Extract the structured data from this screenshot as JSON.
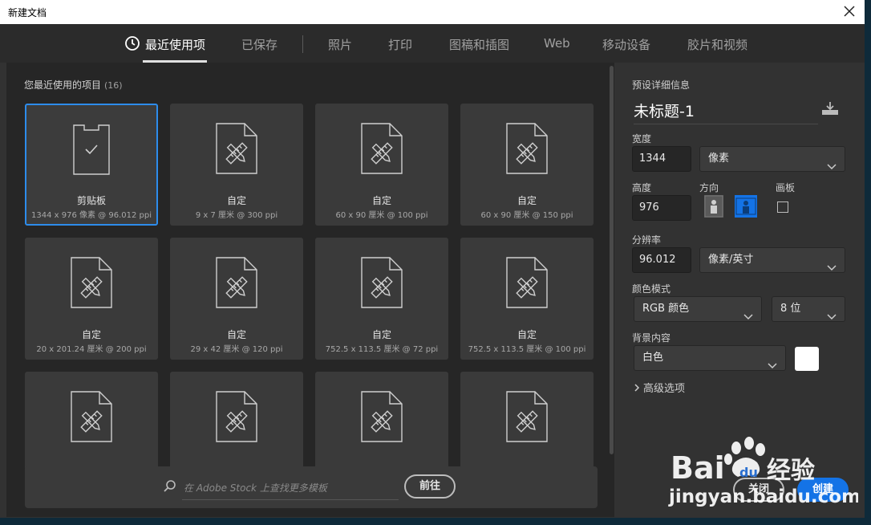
{
  "window": {
    "title": "新建文档"
  },
  "tabs": [
    {
      "label": "最近使用项",
      "active": true
    },
    {
      "label": "已保存"
    },
    {
      "label": "照片"
    },
    {
      "label": "打印"
    },
    {
      "label": "图稿和插图"
    },
    {
      "label": "Web"
    },
    {
      "label": "移动设备"
    },
    {
      "label": "胶片和视频"
    }
  ],
  "recent": {
    "title": "您最近使用的项目",
    "count": "(16)",
    "items": [
      {
        "name": "剪贴板",
        "desc": "1344 x 976 像素 @ 96.012 ppi",
        "icon": "clipboard-check-icon",
        "selected": true
      },
      {
        "name": "自定",
        "desc": "9 x 7 厘米 @ 300 ppi",
        "icon": "custom-document-icon"
      },
      {
        "name": "自定",
        "desc": "60 x 90 厘米 @ 100 ppi",
        "icon": "custom-document-icon"
      },
      {
        "name": "自定",
        "desc": "60 x 90 厘米 @ 150 ppi",
        "icon": "custom-document-icon"
      },
      {
        "name": "自定",
        "desc": "20 x 201.24 厘米 @ 200 ppi",
        "icon": "custom-document-icon"
      },
      {
        "name": "自定",
        "desc": "29 x 42 厘米 @ 120 ppi",
        "icon": "custom-document-icon"
      },
      {
        "name": "自定",
        "desc": "752.5 x 113.5 厘米 @ 72 ppi",
        "icon": "custom-document-icon"
      },
      {
        "name": "自定",
        "desc": "752.5 x 113.5 厘米 @ 100 ppi",
        "icon": "custom-document-icon"
      },
      {
        "name": "",
        "desc": "",
        "icon": "custom-document-icon"
      },
      {
        "name": "",
        "desc": "",
        "icon": "custom-document-icon"
      },
      {
        "name": "",
        "desc": "",
        "icon": "custom-document-icon"
      },
      {
        "name": "",
        "desc": "",
        "icon": "custom-document-icon"
      }
    ]
  },
  "stock": {
    "placeholder": "在 Adobe Stock 上查找更多模板",
    "go_label": "前往"
  },
  "preset": {
    "section_title": "预设详细信息",
    "name": "未标题-1",
    "width_label": "宽度",
    "width_value": "1344",
    "width_unit": "像素",
    "height_label": "高度",
    "height_value": "976",
    "orientation_label": "方向",
    "artboard_label": "画板",
    "resolution_label": "分辨率",
    "resolution_value": "96.012",
    "resolution_unit": "像素/英寸",
    "color_mode_label": "颜色模式",
    "color_mode_value": "RGB 颜色",
    "bit_depth_value": "8 位",
    "background_label": "背景内容",
    "background_value": "白色",
    "background_color": "#ffffff",
    "advanced_label": "高级选项"
  },
  "actions": {
    "close_label": "关闭",
    "create_label": "创建"
  },
  "watermark": {
    "brand": "Bai",
    "brand2": "du",
    "brand3": "经验",
    "url": "jingyan.baidu.com"
  },
  "colors": {
    "accent": "#1473e6",
    "selected_border": "#2d8ceb"
  }
}
